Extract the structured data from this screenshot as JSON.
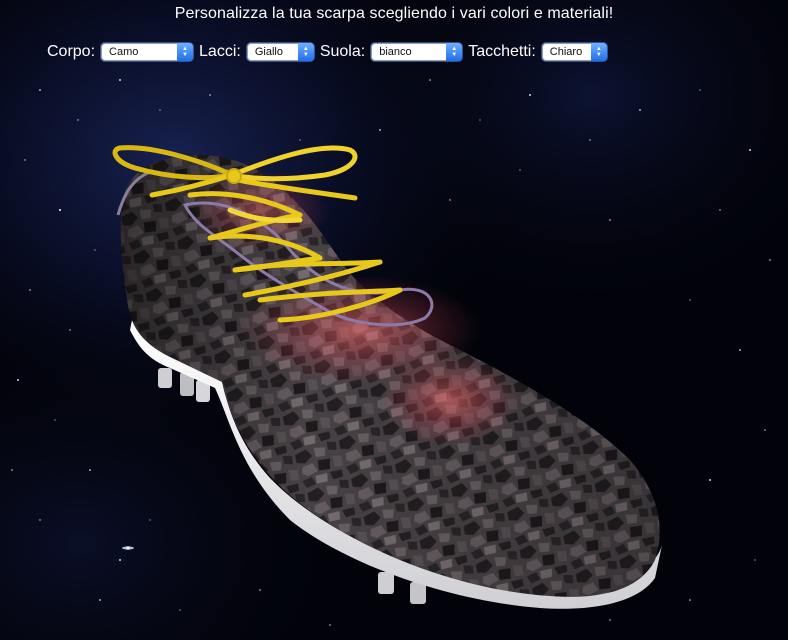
{
  "heading": "Personalizza la tua scarpa scegliendo i vari colori e materiali!",
  "controls": {
    "corpo": {
      "label": "Corpo:",
      "value": "Camo"
    },
    "lacci": {
      "label": "Lacci:",
      "value": "Giallo"
    },
    "suola": {
      "label": "Suola:",
      "value": "bianco"
    },
    "tacchetti": {
      "label": "Tacchetti:",
      "value": "Chiaro"
    }
  },
  "scene": {
    "background": "#02030a",
    "body_color": "#4a4347",
    "lace_color": "#e8c81a",
    "sole_color": "#ffffff",
    "studs_color": "#d8d8d8",
    "select_accent": "#2a7cf0"
  }
}
